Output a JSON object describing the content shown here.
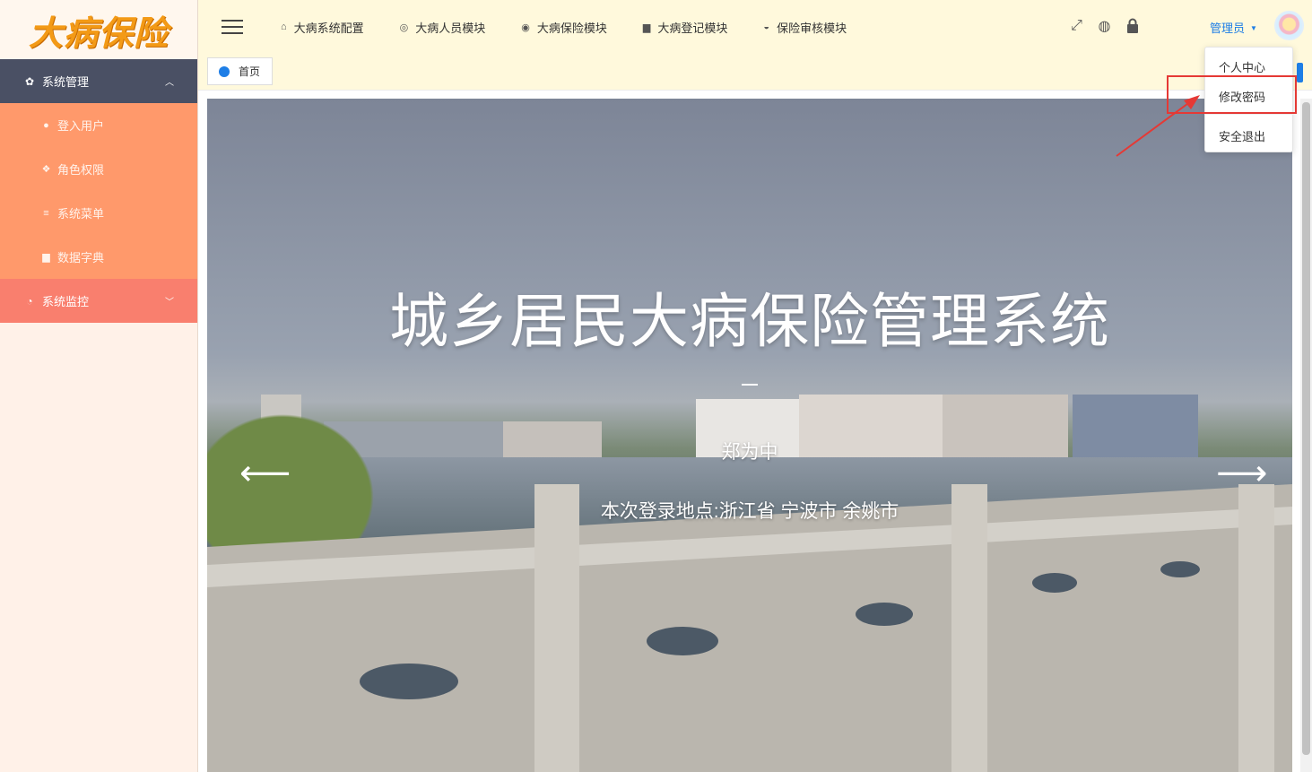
{
  "sidebar": {
    "logo_text": "大病保险",
    "groups": [
      {
        "label": "系统管理",
        "icon": "gear-icon",
        "expanded": true,
        "items": [
          {
            "label": "登入用户",
            "icon": "user-icon"
          },
          {
            "label": "角色权限",
            "icon": "users-icon"
          },
          {
            "label": "系统菜单",
            "icon": "list-icon"
          },
          {
            "label": "数据字典",
            "icon": "book-icon"
          }
        ]
      },
      {
        "label": "系统监控",
        "icon": "dashboard-icon",
        "expanded": false,
        "items": []
      }
    ]
  },
  "topbar": {
    "nav": [
      {
        "label": "大病系统配置",
        "icon": "home-icon"
      },
      {
        "label": "大病人员模块",
        "icon": "circle-gear-icon"
      },
      {
        "label": "大病保险模块",
        "icon": "circle-at-icon"
      },
      {
        "label": "大病登记模块",
        "icon": "doc-icon"
      },
      {
        "label": "保险审核模块",
        "icon": "circle-arrow-icon"
      }
    ],
    "tools": [
      "fullscreen-icon",
      "globe-icon",
      "lock-icon"
    ],
    "user_label": "管理员"
  },
  "tabs": [
    {
      "label": "首页",
      "active": true
    }
  ],
  "carousel": {
    "title": "城乡居民大病保险管理系统",
    "subtitle": "郑为中",
    "location": "本次登录地点:浙江省 宁波市 余姚市"
  },
  "user_menu": {
    "items": [
      "个人中心",
      "修改密码",
      "安全退出"
    ],
    "highlighted": "修改密码"
  },
  "colors": {
    "sidebar_group_dark": "#4a5064",
    "sidebar_submenu": "#ff996b",
    "sidebar_group_coral": "#f97f6e",
    "topbar_bg": "#fff9dc",
    "accent_blue": "#1e7ee6",
    "annotation_red": "#e53935"
  }
}
